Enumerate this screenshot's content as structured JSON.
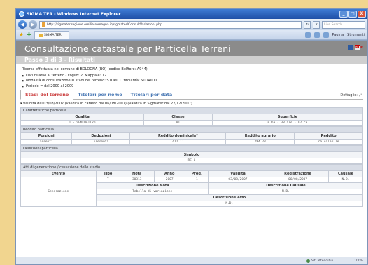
{
  "window": {
    "title": "SIGMA TER - Windows Internet Explorer",
    "minimize": "_",
    "maximize": "□",
    "close": "X"
  },
  "address": {
    "url": "http://sigmater.regione.emilia-romagna.it/sigmater/ConsultVariazioni.php",
    "live_search": "Live Search"
  },
  "browser_tab": {
    "label": "SIGMA TER"
  },
  "toolbar": {
    "pagina": "Pagina",
    "strumenti": "Strumenti"
  },
  "page": {
    "title": "Consultazione catastale per Particella Terreni",
    "step": "Passo 3 di 3 - Risultati",
    "intro": "Ricerca effettuata nel comune di BOLOGNA (BO) (codice Belfiore: A944)",
    "criteria": [
      "Dati relativi al terreno - Foglio: 2, Mappale: 12",
      "Modalità di consultazione = stadi del terreno: STORICO  titolarità: STORICO",
      "Periodo = dal 2000 al 2009"
    ],
    "pdf": "PDF"
  },
  "tabs": [
    {
      "label": "Stadi del terreno"
    },
    {
      "label": "Titolari per nome"
    },
    {
      "label": "Titolari per data"
    }
  ],
  "dettaglio": "Dettaglio:",
  "validity": "validita dal 03/08/2007 (validita in catasto dal 06/08/2007) (validita in Sigmater dal 27/12/2007)",
  "caratteristiche": {
    "title": "Caratteristiche particella",
    "headers": [
      "Qualita",
      "Classe",
      "Superficie"
    ],
    "row": [
      "1 - SEMINATIVO",
      "01",
      "0 ha - 38 are - 97 ca"
    ]
  },
  "reddito": {
    "title": "Reddito particella",
    "headers": [
      "Porzioni",
      "Deduzioni",
      "Reddito dominicale*",
      "Reddito agrario",
      "Reddito"
    ],
    "row": [
      "assenti",
      "presenti",
      "412.11",
      "294.73",
      "calcolabile"
    ]
  },
  "deduzioni": {
    "title": "Deduzioni particella",
    "header": "Simbolo",
    "value": "DELA"
  },
  "atti": {
    "title": "Atti di generazione / cessazione dello stadio",
    "headers": [
      "Evento",
      "Tipo",
      "Nota",
      "Anno",
      "Prog.",
      "Validita",
      "Registrazione",
      "Causale"
    ],
    "event": "Generazione",
    "row": [
      "T",
      "30313",
      "2007",
      "1",
      "03/08/2007",
      "06/08/2007",
      "N.D."
    ],
    "desc_nota_label": "Descrizione Nota",
    "desc_causale_label": "Descrizione Causale",
    "desc_nota": "Tabella di variazione",
    "desc_causale": "N.D.",
    "desc_atto_label": "Descrizione Atto",
    "desc_atto": "N.D."
  },
  "status": {
    "zone": "Siti attendibili",
    "zoom": "100%"
  }
}
